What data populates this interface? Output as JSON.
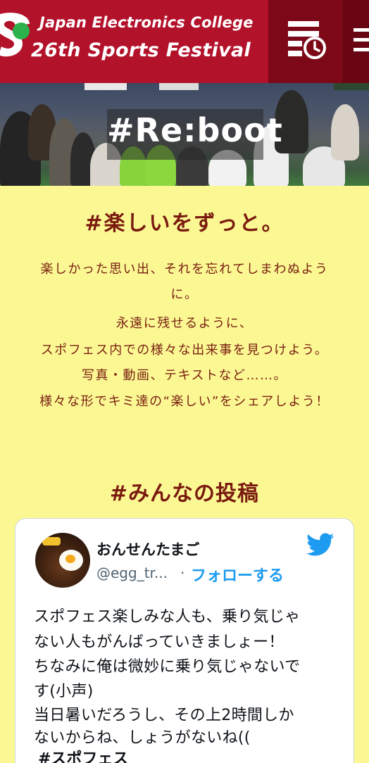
{
  "header": {
    "logo_line1": "Japan Electronics College",
    "logo_line2": "26th Sports Festival",
    "schedule_icon": "schedule-list-clock-icon",
    "menu_icon": "hamburger-menu-icon",
    "brand_color": "#b3122b",
    "accent_color": "#2bb24c"
  },
  "hero": {
    "title": "#Re:boot"
  },
  "intro": {
    "heading": "#楽しいをずっと。",
    "lines": [
      "楽しかった思い出、それを忘れてしまわぬよう",
      "に。",
      "永遠に残せるように、",
      "スポフェス内での様々な出来事を見つけよう。",
      "写真・動画、テキストなど……。",
      "様々な形でキミ達の“楽しい”をシェアしよう！"
    ]
  },
  "posts": {
    "heading": "#みんなの投稿",
    "tweet": {
      "display_name": "おんせんたまご",
      "handle": "@egg_tr...",
      "separator": "·",
      "follow_label": "フォローする",
      "text_lines": [
        "スポフェス楽しみな人も、乗り気じゃ",
        "ない人もがんばっていきましょー！",
        "ちなみに俺は微妙に乗り気じゃないで",
        "す(小声)",
        "当日暑いだろうし、その上2時間しか",
        "ないからね、しょうがないね(("
      ],
      "hashtag": "#スポフェス",
      "brand_icon": "twitter-bird-icon",
      "link_color": "#1d9bf0"
    }
  }
}
